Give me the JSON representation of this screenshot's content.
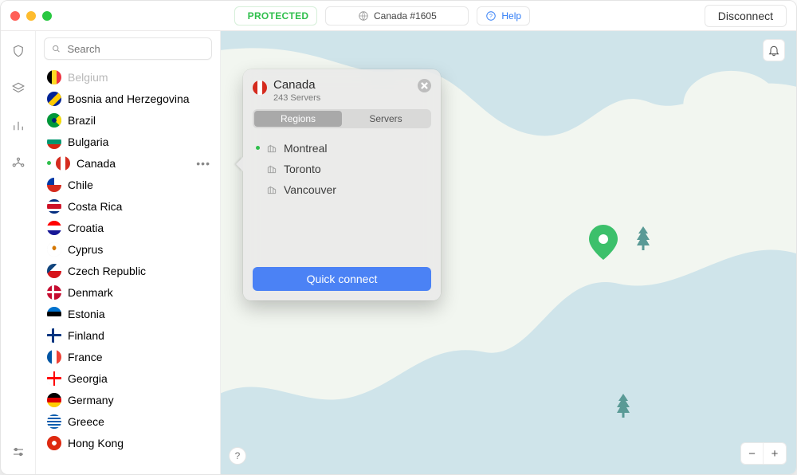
{
  "titlebar": {
    "status_label": "PROTECTED",
    "server_label": "Canada #1605",
    "help_label": "Help",
    "disconnect_label": "Disconnect"
  },
  "search": {
    "placeholder": "Search"
  },
  "countries": [
    {
      "name": "Belgium",
      "faded": true,
      "flag": "be"
    },
    {
      "name": "Bosnia and Herzegovina",
      "flag": "ba"
    },
    {
      "name": "Brazil",
      "flag": "br"
    },
    {
      "name": "Bulgaria",
      "flag": "bg"
    },
    {
      "name": "Canada",
      "flag": "ca",
      "connected": true,
      "selected": true
    },
    {
      "name": "Chile",
      "flag": "cl"
    },
    {
      "name": "Costa Rica",
      "flag": "cr"
    },
    {
      "name": "Croatia",
      "flag": "hr"
    },
    {
      "name": "Cyprus",
      "flag": "cy"
    },
    {
      "name": "Czech Republic",
      "flag": "cz"
    },
    {
      "name": "Denmark",
      "flag": "dk"
    },
    {
      "name": "Estonia",
      "flag": "ee"
    },
    {
      "name": "Finland",
      "flag": "fi"
    },
    {
      "name": "France",
      "flag": "fr"
    },
    {
      "name": "Georgia",
      "flag": "ge"
    },
    {
      "name": "Germany",
      "flag": "de"
    },
    {
      "name": "Greece",
      "flag": "gr"
    },
    {
      "name": "Hong Kong",
      "flag": "hk"
    }
  ],
  "popover": {
    "title": "Canada",
    "subtitle": "243 Servers",
    "tabs": {
      "regions": "Regions",
      "servers": "Servers",
      "active": "regions"
    },
    "regions": [
      {
        "name": "Montreal",
        "connected": true
      },
      {
        "name": "Toronto",
        "connected": false
      },
      {
        "name": "Vancouver",
        "connected": false
      }
    ],
    "quick_connect_label": "Quick connect"
  },
  "map": {
    "zoom_out": "−",
    "zoom_in": "+",
    "help_symbol": "?"
  }
}
